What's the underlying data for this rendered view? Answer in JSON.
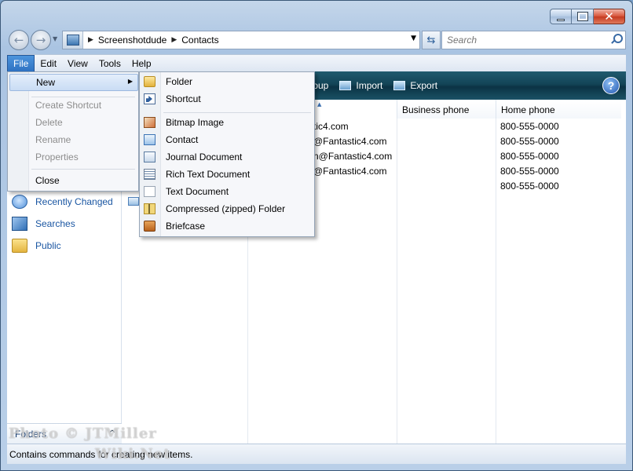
{
  "window": {
    "caption": {
      "minimize": "",
      "maximize": "",
      "close": "✕"
    }
  },
  "address_bar": {
    "breadcrumbs": [
      "Screenshotdude",
      "Contacts"
    ],
    "search_placeholder": "Search"
  },
  "menubar": {
    "items": [
      {
        "label": "File",
        "active": true
      },
      {
        "label": "Edit"
      },
      {
        "label": "View"
      },
      {
        "label": "Tools"
      },
      {
        "label": "Help"
      }
    ]
  },
  "command_bar": {
    "items": [
      "Group",
      "Import",
      "Export"
    ],
    "help": "?"
  },
  "nav_pane": {
    "links": [
      "Recently Changed",
      "Searches",
      "Public"
    ],
    "folders_label": "Folders"
  },
  "file_list": {
    "columns": [
      "Business phone",
      "Home phone"
    ],
    "rows": [
      {
        "email_fragment": "tic4.com",
        "home_phone": "800-555-0000"
      },
      {
        "email_fragment": "@Fantastic4.com",
        "home_phone": "800-555-0000"
      },
      {
        "email_fragment": "n@Fantastic4.com",
        "home_phone": "800-555-0000"
      },
      {
        "email_fragment": "@Fantastic4.com",
        "home_phone": "800-555-0000"
      },
      {
        "email_fragment": "",
        "home_phone": "800-555-0000"
      }
    ]
  },
  "file_menu": {
    "new_label": "New",
    "items": [
      "Create Shortcut",
      "Delete",
      "Rename",
      "Properties"
    ],
    "close_label": "Close"
  },
  "new_submenu": {
    "items": [
      {
        "label": "Folder",
        "icon": "folder-icon"
      },
      {
        "label": "Shortcut",
        "icon": "shortcut-icon"
      },
      {
        "label": "Bitmap Image",
        "icon": "bitmap-icon"
      },
      {
        "label": "Contact",
        "icon": "contact-icon"
      },
      {
        "label": "Journal Document",
        "icon": "journal-icon"
      },
      {
        "label": "Rich Text Document",
        "icon": "rtf-icon"
      },
      {
        "label": "Text Document",
        "icon": "text-doc-icon"
      },
      {
        "label": "Compressed (zipped) Folder",
        "icon": "zip-folder-icon"
      },
      {
        "label": "Briefcase",
        "icon": "briefcase-icon"
      }
    ]
  },
  "status_bar": {
    "text": "Contains commands for creating new items."
  },
  "watermark": {
    "line1": "Photo © JTMiller",
    "line2": "Wiki.Net"
  },
  "colors": {
    "menu_active": "#2f72c2",
    "command_bar": "#134457",
    "link": "#1a56a2"
  }
}
